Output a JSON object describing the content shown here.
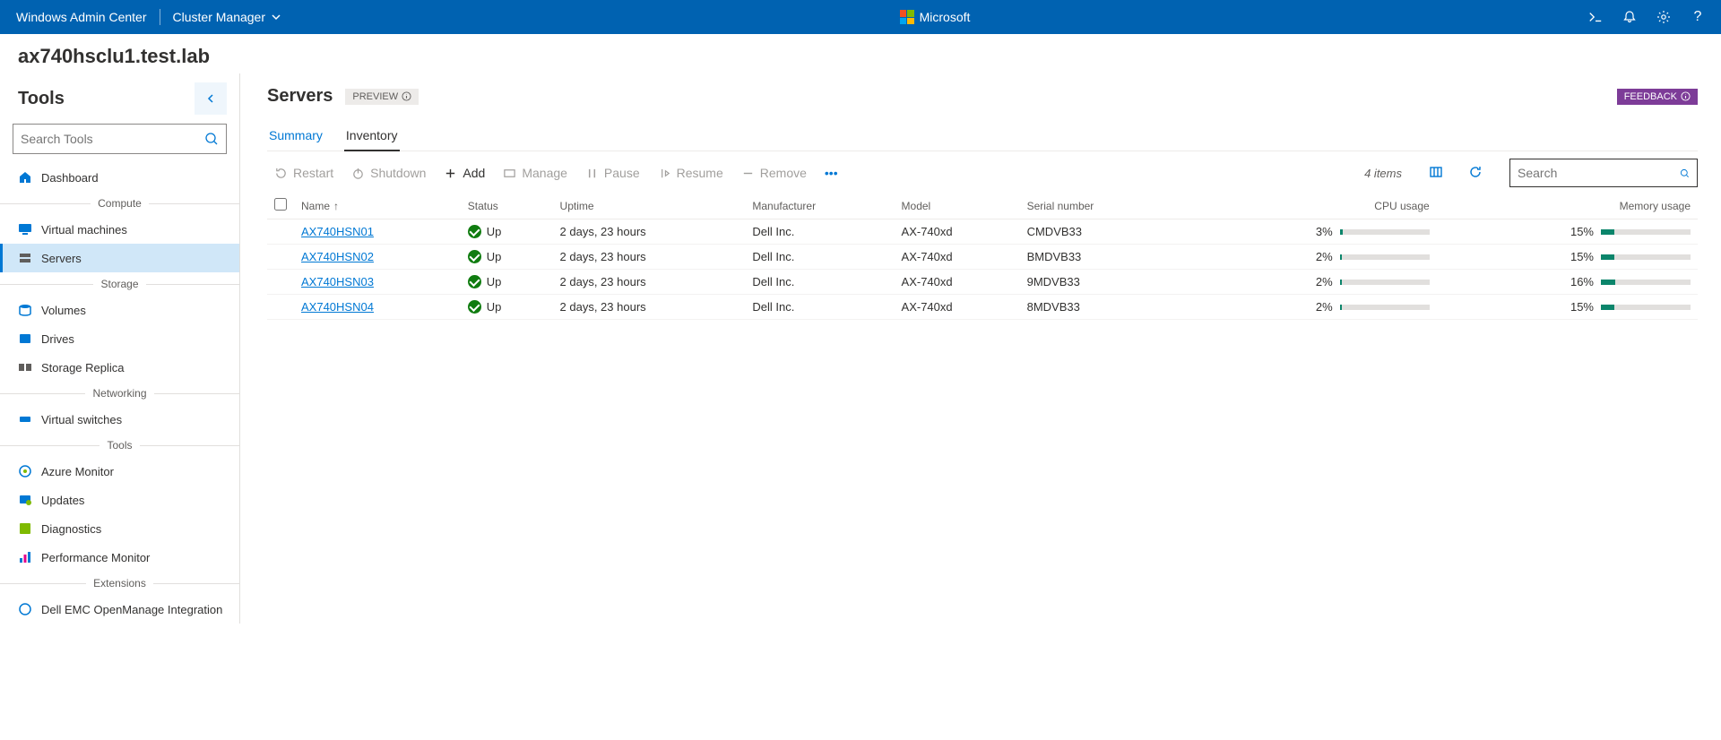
{
  "topbar": {
    "brand": "Windows Admin Center",
    "context": "Cluster Manager",
    "ms_label": "Microsoft"
  },
  "page_title": "ax740hsclu1.test.lab",
  "sidebar": {
    "tools_label": "Tools",
    "search_placeholder": "Search Tools",
    "dashboard": "Dashboard",
    "group_compute": "Compute",
    "vm": "Virtual machines",
    "servers": "Servers",
    "group_storage": "Storage",
    "volumes": "Volumes",
    "drives": "Drives",
    "storage_replica": "Storage Replica",
    "group_networking": "Networking",
    "vswitches": "Virtual switches",
    "group_tools": "Tools",
    "azure_monitor": "Azure Monitor",
    "updates": "Updates",
    "diagnostics": "Diagnostics",
    "perfmon": "Performance Monitor",
    "group_extensions": "Extensions",
    "dell": "Dell EMC OpenManage Integration"
  },
  "main": {
    "title": "Servers",
    "preview": "PREVIEW",
    "feedback": "FEEDBACK",
    "tabs": {
      "summary": "Summary",
      "inventory": "Inventory"
    },
    "toolbar": {
      "restart": "Restart",
      "shutdown": "Shutdown",
      "add": "Add",
      "manage": "Manage",
      "pause": "Pause",
      "resume": "Resume",
      "remove": "Remove"
    },
    "items_count": "4 items",
    "search_placeholder": "Search",
    "columns": {
      "name": "Name",
      "status": "Status",
      "uptime": "Uptime",
      "manufacturer": "Manufacturer",
      "model": "Model",
      "serial": "Serial number",
      "cpu": "CPU usage",
      "memory": "Memory usage"
    },
    "rows": [
      {
        "name": "AX740HSN01",
        "status": "Up",
        "uptime": "2 days, 23 hours",
        "manufacturer": "Dell Inc.",
        "model": "AX-740xd",
        "serial": "CMDVB33",
        "cpu": "3%",
        "cpu_pct": 3,
        "mem": "15%",
        "mem_pct": 15
      },
      {
        "name": "AX740HSN02",
        "status": "Up",
        "uptime": "2 days, 23 hours",
        "manufacturer": "Dell Inc.",
        "model": "AX-740xd",
        "serial": "BMDVB33",
        "cpu": "2%",
        "cpu_pct": 2,
        "mem": "15%",
        "mem_pct": 15
      },
      {
        "name": "AX740HSN03",
        "status": "Up",
        "uptime": "2 days, 23 hours",
        "manufacturer": "Dell Inc.",
        "model": "AX-740xd",
        "serial": "9MDVB33",
        "cpu": "2%",
        "cpu_pct": 2,
        "mem": "16%",
        "mem_pct": 16
      },
      {
        "name": "AX740HSN04",
        "status": "Up",
        "uptime": "2 days, 23 hours",
        "manufacturer": "Dell Inc.",
        "model": "AX-740xd",
        "serial": "8MDVB33",
        "cpu": "2%",
        "cpu_pct": 2,
        "mem": "15%",
        "mem_pct": 15
      }
    ]
  }
}
